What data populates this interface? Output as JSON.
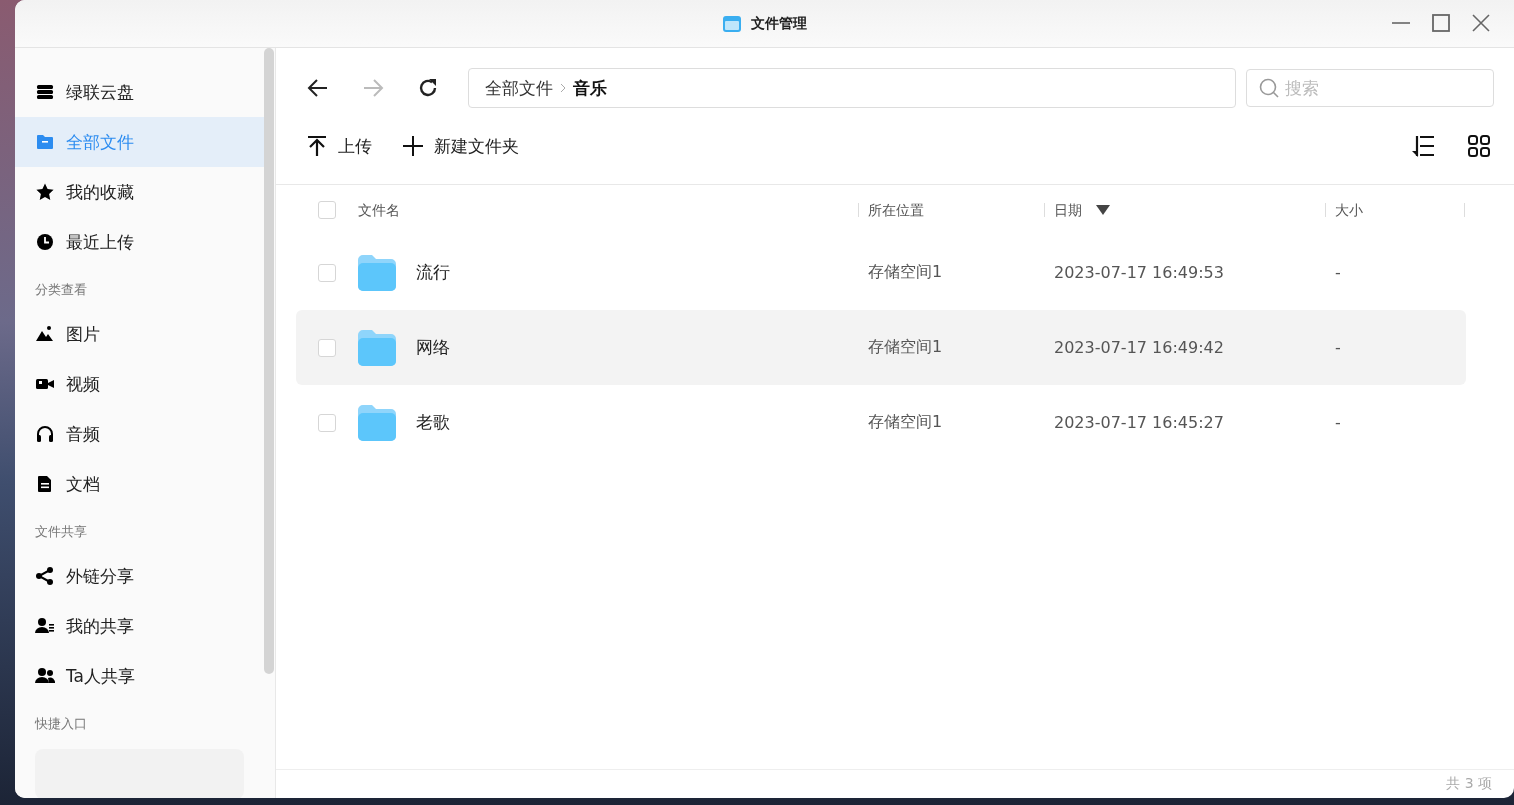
{
  "window": {
    "title": "文件管理"
  },
  "sidebar": {
    "sections": [
      {
        "items": [
          {
            "label": "绿联云盘",
            "kind": "storage",
            "selected": false
          },
          {
            "label": "全部文件",
            "kind": "folder",
            "selected": true
          },
          {
            "label": "我的收藏",
            "kind": "star",
            "selected": false
          },
          {
            "label": "最近上传",
            "kind": "clock",
            "selected": false
          }
        ]
      },
      {
        "heading": "分类查看",
        "items": [
          {
            "label": "图片",
            "kind": "image",
            "selected": false
          },
          {
            "label": "视频",
            "kind": "video",
            "selected": false
          },
          {
            "label": "音频",
            "kind": "headphones",
            "selected": false
          },
          {
            "label": "文档",
            "kind": "document",
            "selected": false
          }
        ]
      },
      {
        "heading": "文件共享",
        "items": [
          {
            "label": "外链分享",
            "kind": "share",
            "selected": false
          },
          {
            "label": "我的共享",
            "kind": "user-list",
            "selected": false
          },
          {
            "label": "Ta人共享",
            "kind": "users",
            "selected": false
          }
        ]
      },
      {
        "heading": "快捷入口"
      }
    ]
  },
  "breadcrumb": [
    "全部文件",
    "音乐"
  ],
  "search": {
    "placeholder": "搜索"
  },
  "actions": [
    "上传",
    "新建文件夹"
  ],
  "table": {
    "select_all_checked": false,
    "columns": [
      "文件名",
      "所在位置",
      "日期",
      "大小"
    ],
    "rows": [
      {
        "checked": false,
        "hovered": false,
        "name": "流行",
        "location": "存储空间1",
        "date": "2023-07-17 16:49:53",
        "size": "-"
      },
      {
        "checked": false,
        "hovered": true,
        "name": "网络",
        "location": "存储空间1",
        "date": "2023-07-17 16:49:42",
        "size": "-"
      },
      {
        "checked": false,
        "hovered": false,
        "name": "老歌",
        "location": "存储空间1",
        "date": "2023-07-17 16:45:27",
        "size": "-"
      }
    ]
  },
  "status_bar": "共 3 项"
}
